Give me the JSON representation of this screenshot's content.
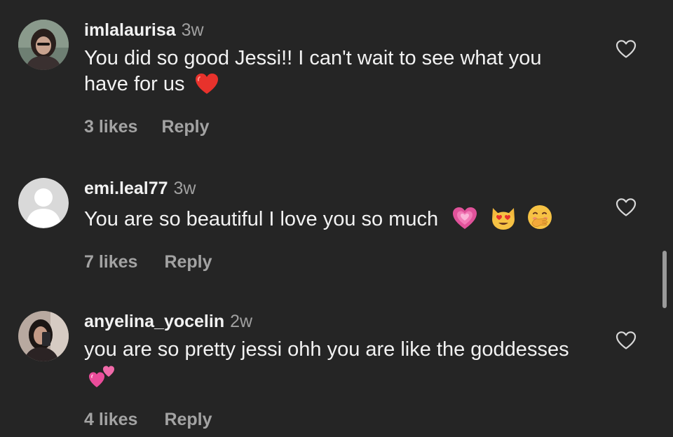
{
  "comments": [
    {
      "username": "imlalaurisa",
      "time": "3w",
      "text": "You did so good Jessi!! I can't wait to see what you have for us",
      "emoji": [
        "red-heart"
      ],
      "likes": "3 likes",
      "reply": "Reply"
    },
    {
      "username": "emi.leal77",
      "time": "3w",
      "text": "You are so beautiful I love you so much",
      "emoji": [
        "growing-heart",
        "heart-eyes-cat",
        "hand-over-mouth"
      ],
      "likes": "7 likes",
      "reply": "Reply"
    },
    {
      "username": "anyelina_yocelin",
      "time": "2w",
      "text": "you are so pretty jessi ohh you are like the goddesses",
      "emoji": [
        "two-hearts"
      ],
      "likes": "4 likes",
      "reply": "Reply"
    }
  ],
  "colors": {
    "background": "#252525",
    "text": "#f2f2f2",
    "secondary": "#a0a0a0"
  },
  "icons": {
    "like": "heart-outline-icon",
    "default_avatar": "person-silhouette-icon"
  }
}
